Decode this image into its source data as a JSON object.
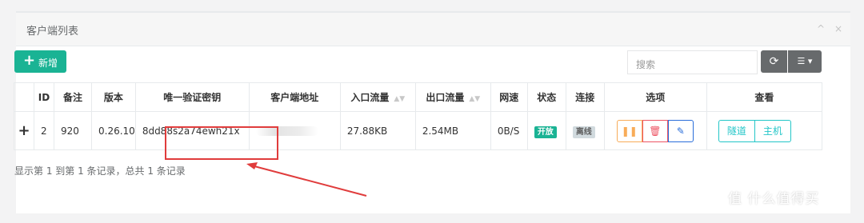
{
  "panel": {
    "title": "客户端列表",
    "tools": [
      "^",
      "×"
    ]
  },
  "toolbar": {
    "add_label": "新增",
    "search_placeholder": "搜索"
  },
  "table": {
    "headers": [
      "",
      "ID",
      "备注",
      "版本",
      "唯一验证密钥",
      "客户端地址",
      "入口流量",
      "出口流量",
      "网速",
      "状态",
      "连接",
      "选项",
      "查看"
    ],
    "row": {
      "expand": "+",
      "id": "2",
      "remark": "920",
      "version": "0.26.10",
      "key": "8dd88s2a74ewh21x",
      "in_traffic": "27.88KB",
      "out_traffic": "2.54MB",
      "speed": "0B/S",
      "status": "开放",
      "connection": "离线",
      "view_tunnel": "隧道",
      "view_host": "主机"
    }
  },
  "footer": {
    "summary": "显示第 1 到第 1 条记录，总共 1 条记录"
  },
  "watermark": "值 什么值得买",
  "colors": {
    "primary": "#1ab394",
    "warning": "#f8ac59",
    "danger": "#ed5565",
    "info": "#23c6c8",
    "annotation": "#e03c3c"
  }
}
